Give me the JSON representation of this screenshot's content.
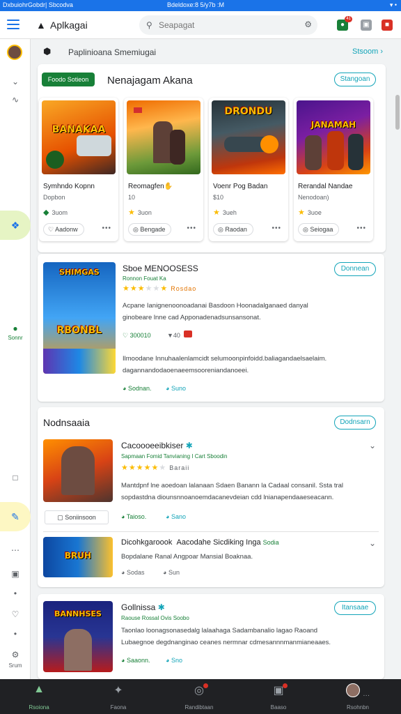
{
  "status_bar": {
    "left": "Dxbuiohr​Gobdr| Sbcodva",
    "center": "Bdeldoxe:8 5/y7b :M",
    "right": "▾ •"
  },
  "app": {
    "title": "Aplkagai",
    "logo": "▲"
  },
  "search": {
    "placeholder": "Seapagat"
  },
  "top_actions": {
    "notify_badge": "41"
  },
  "rail": {
    "active_label": "Sonnr",
    "bottom_label": "Srum"
  },
  "section_row": {
    "title": "Paplinioana Smemiugai",
    "link": "Stsoom ›"
  },
  "featured": {
    "chip": "Foodo Sotieon",
    "title": "Nenajagam Akana",
    "button": "Stangoan",
    "games": [
      {
        "art_text": "BANAKAA",
        "name": "Symhndo Kopnn",
        "sub": "Dopbon",
        "rating": "3uom",
        "action": "Aadonw"
      },
      {
        "art_text": "",
        "name": "Reomagfen✋",
        "sub": "10",
        "rating": "3uon",
        "action": "Bengade"
      },
      {
        "art_text": "DRONDU",
        "name": "Voenr Pog Badan",
        "sub": "$10",
        "rating": "3ueh",
        "action": "Raodan"
      },
      {
        "art_text": "JANAMAH",
        "name": "Rerandal Nandae",
        "sub": "Nenodoan)",
        "rating": "3uoe",
        "action": "Seiogaa"
      }
    ]
  },
  "spotlight": {
    "art_text_top": "SHIMGAS",
    "art_text_bottom": "RBONBL",
    "title": "Sboe MENOOSESS",
    "meta": "Ronnon Fouat Ka",
    "rating_label": "Rosdao",
    "button": "Donnean",
    "desc1": "Acpane Ianignenoonoadanai Basdoon Hoonadalganaed danyal",
    "desc2": "ginobeare lnne cad Apponadenadsunsansonat.",
    "price": "300010",
    "size": "40",
    "desc3": "Ilmoodane Innuhaalenlamcidt  selumoonpinfoidd.baliagandaelsaelaim.",
    "desc4": "dagannandodaoenaeemsooreniandanoeei.",
    "footer_left": "Sodnan.",
    "footer_right": "Suno"
  },
  "section2": {
    "title": "Nodnsaaia",
    "button": "Dodnsarn"
  },
  "list": [
    {
      "art_text": "",
      "title": "Cacoooeeibkiser",
      "meta": "Sapmaan Fomid Tanvianing I Cart Sboodin",
      "rating_label": "Baraii",
      "desc1": "Mantdpnf lne aoedoan lalanaan Sdaen Banann la Cadaal consanil. Ssta tral",
      "desc2": "sopdastdna diounsnnoanoemdacanevdeian cdd lnianapendaaeseacann.",
      "action": "Soniinsoon",
      "price": "Taioso.",
      "tag": "Sano"
    },
    {
      "art_text": "BRUH",
      "title": "Dicohkgaroook",
      "subtitle": "Aacodahe Sicdiking Inga",
      "badge": "Sodia",
      "desc": "Bopdalane Ranal Angpoar Mansial Boaknaa.",
      "price": "Sodas",
      "tag": "Sun"
    },
    {
      "art_text": "BANNHSES",
      "title": "Gollnissa",
      "meta": "Raouse Rossal Ovis Soobo",
      "button": "Itansaae",
      "desc1": "Taonlao loonagsonasedalg lalaahaga Sadambanalio lagao Raoand",
      "desc2": "Lubaegnoe degdnanginao ceanes nermnar cdmesannnmanmianeaaes.",
      "price": "Saaonn.",
      "tag": "Sno"
    }
  ],
  "bottom_nav": [
    {
      "label": "Rsoiona",
      "icon": "▲"
    },
    {
      "label": "Faona",
      "icon": "✦"
    },
    {
      "label": "Randibtaan",
      "icon": "◎"
    },
    {
      "label": "Baaso",
      "icon": "▣"
    },
    {
      "label": "Rsohnbn",
      "icon": "●"
    }
  ],
  "colors": {
    "accent": "#12a4b8",
    "brand": "#1a73e8",
    "green": "#188038",
    "star": "#fbbc04"
  }
}
